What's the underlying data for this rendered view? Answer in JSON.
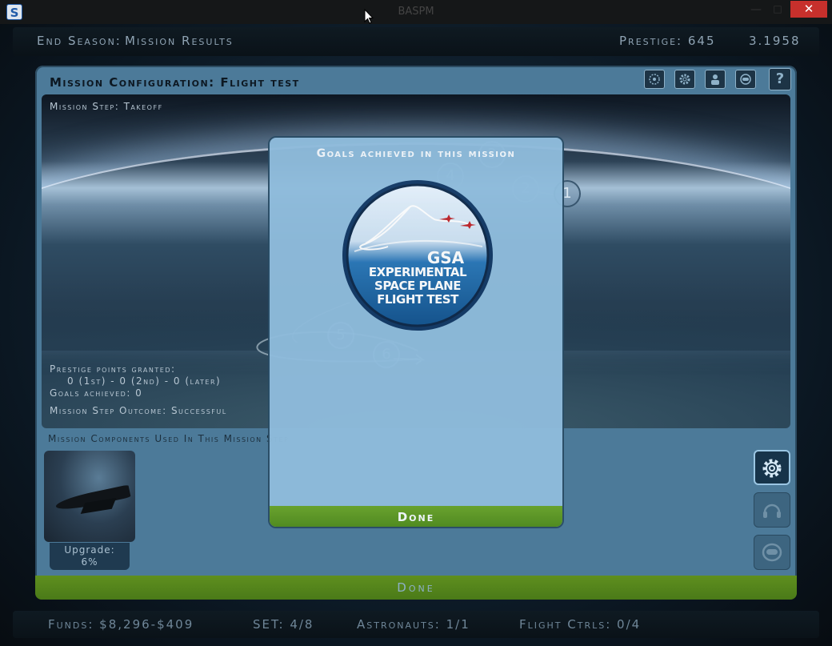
{
  "window": {
    "title": "BASPM",
    "app_icon": "S",
    "controls": {
      "minimize": "—",
      "maximize": "□",
      "close": "✕"
    }
  },
  "topbar": {
    "season_label": "End Season:",
    "mission_results": "Mission Results",
    "prestige": "Prestige: 645",
    "date": "3.1958"
  },
  "panel": {
    "title": "Mission Configuration: Flight test",
    "toolbar_icons": [
      "target-icon",
      "gear-icon",
      "astronaut-icon",
      "helmet-icon",
      "help-icon"
    ],
    "help_label": "?"
  },
  "viewport": {
    "mission_step": "Mission Step: Takeoff",
    "prestige_granted_label": "Prestige points granted:",
    "prestige_breakdown": "0 (1st) - 0 (2nd) - 0 (later)",
    "goals_achieved": "Goals achieved: 0",
    "outcome": "Mission Step Outcome: Successful",
    "step_markers": [
      "1",
      "2",
      "3",
      "4",
      "5",
      "6"
    ]
  },
  "components": {
    "label": "Mission Components Used In This Mission Step",
    "upgrade_label": "Upgrade:",
    "upgrade_value": "6%"
  },
  "side_buttons": [
    "gear-icon",
    "headset-icon",
    "helmet-icon"
  ],
  "done_main": "Done",
  "statusbar": {
    "funds": "Funds: $8,296-$409",
    "set": "SET: 4/8",
    "astronauts": "Astronauts: 1/1",
    "flight_ctrls": "Flight Ctrls: 0/4"
  },
  "modal": {
    "title": "Goals achieved in this mission",
    "badge_lines": [
      "GSA",
      "EXPERIMENTAL",
      "SPACE PLANE",
      "FLIGHT TEST"
    ],
    "done": "Done"
  },
  "colors": {
    "accent_green": "#5f8f1f",
    "panel_blue": "#4c7a99",
    "modal_blue": "#8fbcdc",
    "close_red": "#c7302c"
  }
}
